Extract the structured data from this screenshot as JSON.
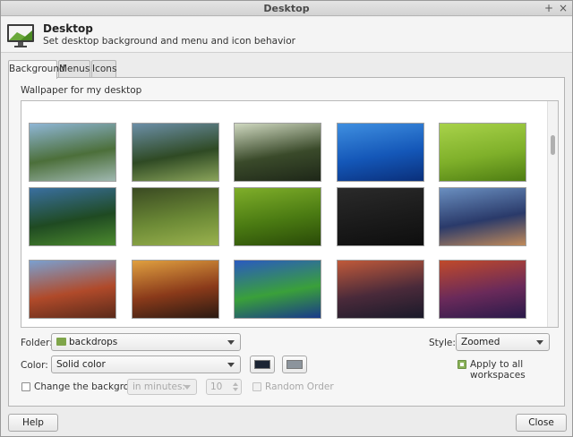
{
  "window": {
    "title": "Desktop"
  },
  "header": {
    "title": "Desktop",
    "subtitle": "Set desktop background and menu and icon behavior"
  },
  "tabs": [
    {
      "label": "Background",
      "active": true
    },
    {
      "label": "Menus",
      "active": false
    },
    {
      "label": "Icons",
      "active": false
    }
  ],
  "background": {
    "section_label": "Wallpaper for my desktop",
    "wallpapers": [
      {
        "name": "mountain-lake",
        "colors": [
          "#8fb6d6",
          "#4c6f3a",
          "#9fb8b0"
        ]
      },
      {
        "name": "green-valley",
        "colors": [
          "#6c8fa8",
          "#2f4a24",
          "#8aa45a"
        ]
      },
      {
        "name": "forest-sunlight",
        "colors": [
          "#cfd8c0",
          "#3a4a2a",
          "#1e2718"
        ]
      },
      {
        "name": "blue-water",
        "colors": [
          "#3f8fe0",
          "#1457b8",
          "#0a2f7a"
        ]
      },
      {
        "name": "green-wave",
        "colors": [
          "#a8d24a",
          "#7fb02a",
          "#4e7d12"
        ]
      },
      {
        "name": "tree-meadow",
        "colors": [
          "#3a6fa0",
          "#1f4a22",
          "#4c8a2e"
        ]
      },
      {
        "name": "grass-field",
        "colors": [
          "#3a4a22",
          "#6c8a36",
          "#9ab24e"
        ]
      },
      {
        "name": "dark-green",
        "colors": [
          "#7fae2a",
          "#4a7a12",
          "#2a4a08"
        ]
      },
      {
        "name": "linux-mint-dark",
        "colors": [
          "#2a2a2a",
          "#1a1a1a",
          "#0e0e0e"
        ]
      },
      {
        "name": "sunset-lake",
        "colors": [
          "#6a8fc0",
          "#2a3a6a",
          "#c08a5a"
        ]
      },
      {
        "name": "red-canyon",
        "colors": [
          "#7aa0d0",
          "#b04a2a",
          "#5a2a1a"
        ]
      },
      {
        "name": "fiery-sunset",
        "colors": [
          "#e0a040",
          "#8a3a1a",
          "#2a1a12"
        ]
      },
      {
        "name": "tropical-island",
        "colors": [
          "#2a5ac0",
          "#3aa03a",
          "#1a3a8a"
        ]
      },
      {
        "name": "dusk-shore",
        "colors": [
          "#c05a3a",
          "#4a2a3a",
          "#1a1a2a"
        ]
      },
      {
        "name": "purple-reflection",
        "colors": [
          "#c04a2a",
          "#6a2a5a",
          "#2a1a4a"
        ]
      }
    ],
    "folder": {
      "label": "Folder:",
      "value": "backdrops"
    },
    "style": {
      "label": "Style:",
      "value": "Zoomed"
    },
    "color": {
      "label": "Color:",
      "value": "Solid color",
      "primary": "#1b2433",
      "secondary": "#8c949c"
    },
    "apply_all": {
      "label": "Apply to all workspaces",
      "checked": true
    },
    "change_background": {
      "label": "Change the background",
      "checked": false
    },
    "interval_unit": {
      "value": "in minutes:"
    },
    "interval_value": "10",
    "random_order": {
      "label": "Random Order",
      "checked": false
    }
  },
  "footer": {
    "help_label": "Help",
    "close_label": "Close"
  },
  "icons": {
    "pin": "+",
    "close": "×",
    "app": "monitor-icon"
  }
}
